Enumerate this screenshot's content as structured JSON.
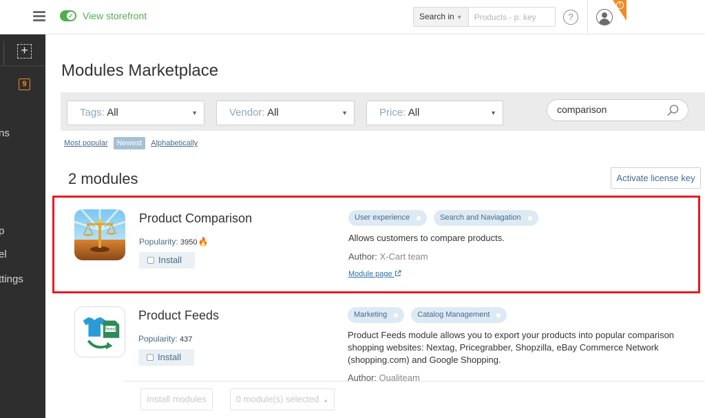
{
  "topbar": {
    "storefront_label": "View storefront",
    "search_in_label": "Search in",
    "search_placeholder": "Products - p: key",
    "help_label": "?",
    "alert_label": "!"
  },
  "sidebar": {
    "badge_count": "9",
    "items": [
      {
        "label": "ns"
      },
      {
        "label": "p"
      },
      {
        "label": "el"
      },
      {
        "label": "ttings"
      }
    ]
  },
  "page": {
    "title": "Modules Marketplace"
  },
  "filters": {
    "tags_label": "Tags:",
    "tags_value": "All",
    "vendor_label": "Vendor:",
    "vendor_value": "All",
    "price_label": "Price:",
    "price_value": "All",
    "search_value": "comparison"
  },
  "sort": {
    "most_popular": "Most popular",
    "newest": "Newest",
    "alphabetically": "Alphabetically"
  },
  "results": {
    "count_label": "2 modules",
    "activate_label": "Activate license key"
  },
  "modules": [
    {
      "title": "Product Comparison",
      "popularity_label": "Popularity:",
      "popularity_value": "3950",
      "install_label": "Install",
      "tags": [
        "User experience",
        "Search and Naviagation"
      ],
      "description": "Allows customers to compare products.",
      "author_label": "Author:",
      "author_value": "X-Cart team",
      "module_page_label": "Module page"
    },
    {
      "title": "Product Feeds",
      "popularity_label": "Popularity:",
      "popularity_value": "437",
      "install_label": "Install",
      "tags": [
        "Marketing",
        "Catalog Management"
      ],
      "description": "Product Feeds module allows you to export your products into popular comparison shopping websites: Nextag, Pricegrabber, Shopzilla, eBay Commerce Network (shopping.com) and Google Shopping.",
      "author_label": "Author:",
      "author_value": "Qualiteam"
    }
  ],
  "bottom_bar": {
    "install_modules_label": "Install modules",
    "selected_label": "0 module(s) selected"
  },
  "colors": {
    "accent_green": "#4caf50",
    "accent_orange": "#f08a24",
    "highlight_red": "#e8191f",
    "link_blue": "#456b8a",
    "sidebar_bg": "#2e2e2e"
  },
  "icons": [
    "menu-icon",
    "check-icon",
    "help-icon",
    "user-icon",
    "alert-icon",
    "add-icon",
    "search-icon",
    "flame-icon",
    "external-link-icon",
    "scales-icon",
    "product-feeds-icon"
  ]
}
